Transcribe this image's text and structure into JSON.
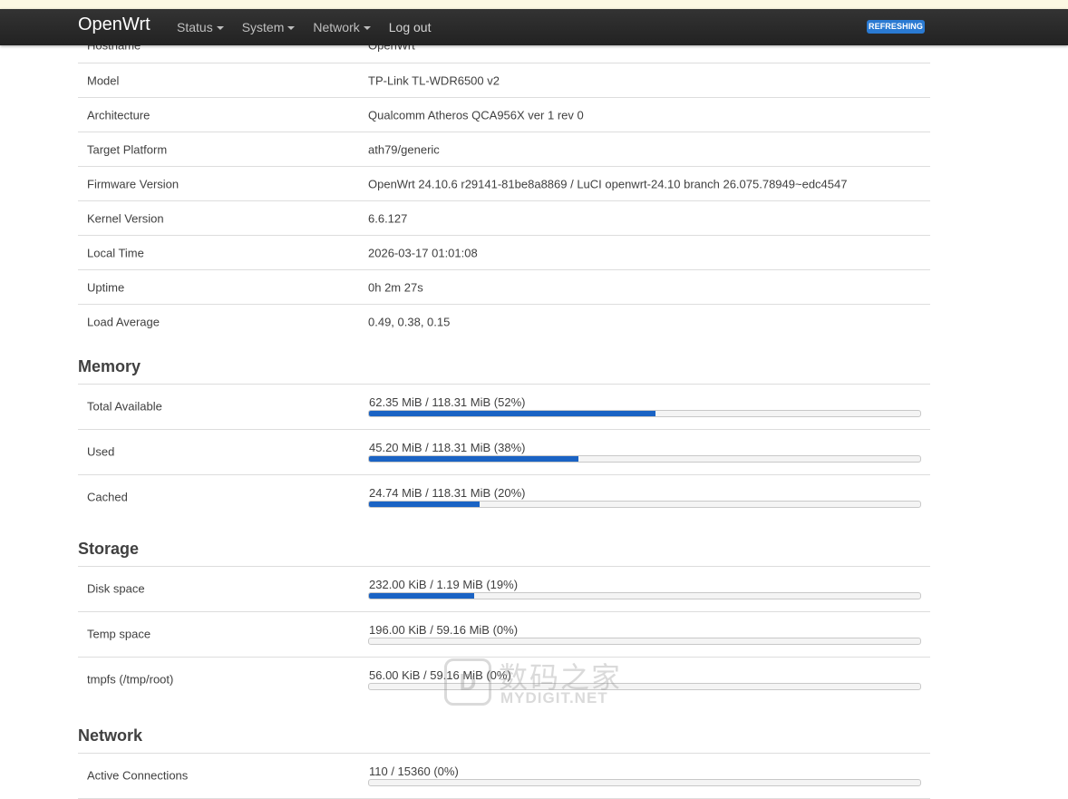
{
  "navbar": {
    "brand": "OpenWrt",
    "menu": [
      {
        "label": "Status",
        "dropdown": true
      },
      {
        "label": "System",
        "dropdown": true
      },
      {
        "label": "Network",
        "dropdown": true
      },
      {
        "label": "Log out",
        "dropdown": false
      }
    ],
    "badge": "REFRESHING",
    "badge_color": "#2a7ad2"
  },
  "system": {
    "rows": [
      {
        "label": "Hostname",
        "value": "OpenWrt"
      },
      {
        "label": "Model",
        "value": "TP-Link TL-WDR6500 v2"
      },
      {
        "label": "Architecture",
        "value": "Qualcomm Atheros QCA956X ver 1 rev 0"
      },
      {
        "label": "Target Platform",
        "value": "ath79/generic"
      },
      {
        "label": "Firmware Version",
        "value": "OpenWrt 24.10.6 r29141-81be8a8869 / LuCI openwrt-24.10 branch 26.075.78949~edc4547"
      },
      {
        "label": "Kernel Version",
        "value": "6.6.127"
      },
      {
        "label": "Local Time",
        "value": "2026-03-17 01:01:08"
      },
      {
        "label": "Uptime",
        "value": "0h 2m 27s"
      },
      {
        "label": "Load Average",
        "value": "0.49, 0.38, 0.15"
      }
    ]
  },
  "memory": {
    "title": "Memory",
    "rows": [
      {
        "label": "Total Available",
        "text": "62.35 MiB / 118.31 MiB (52%)",
        "fraction": 0.52
      },
      {
        "label": "Used",
        "text": "45.20 MiB / 118.31 MiB (38%)",
        "fraction": 0.38
      },
      {
        "label": "Cached",
        "text": "24.74 MiB / 118.31 MiB (20%)",
        "fraction": 0.2
      }
    ]
  },
  "storage": {
    "title": "Storage",
    "rows": [
      {
        "label": "Disk space",
        "text": "232.00 KiB / 1.19 MiB (19%)",
        "fraction": 0.19
      },
      {
        "label": "Temp space",
        "text": "196.00 KiB / 59.16 MiB (0%)",
        "fraction": 0.0
      },
      {
        "label": "tmpfs (/tmp/root)",
        "text": "56.00 KiB / 59.16 MiB (0%)",
        "fraction": 0.0
      }
    ]
  },
  "network": {
    "title": "Network",
    "rows": [
      {
        "label": "Active Connections",
        "text": "110 / 15360 (0%)",
        "fraction": 0.0
      }
    ]
  },
  "watermark": {
    "logo": "D",
    "cn": "数码之家",
    "en": "MYDIGIT.NET"
  },
  "colors": {
    "bar_fill": "#1a63c4",
    "navbar": "#2b2b2b"
  }
}
